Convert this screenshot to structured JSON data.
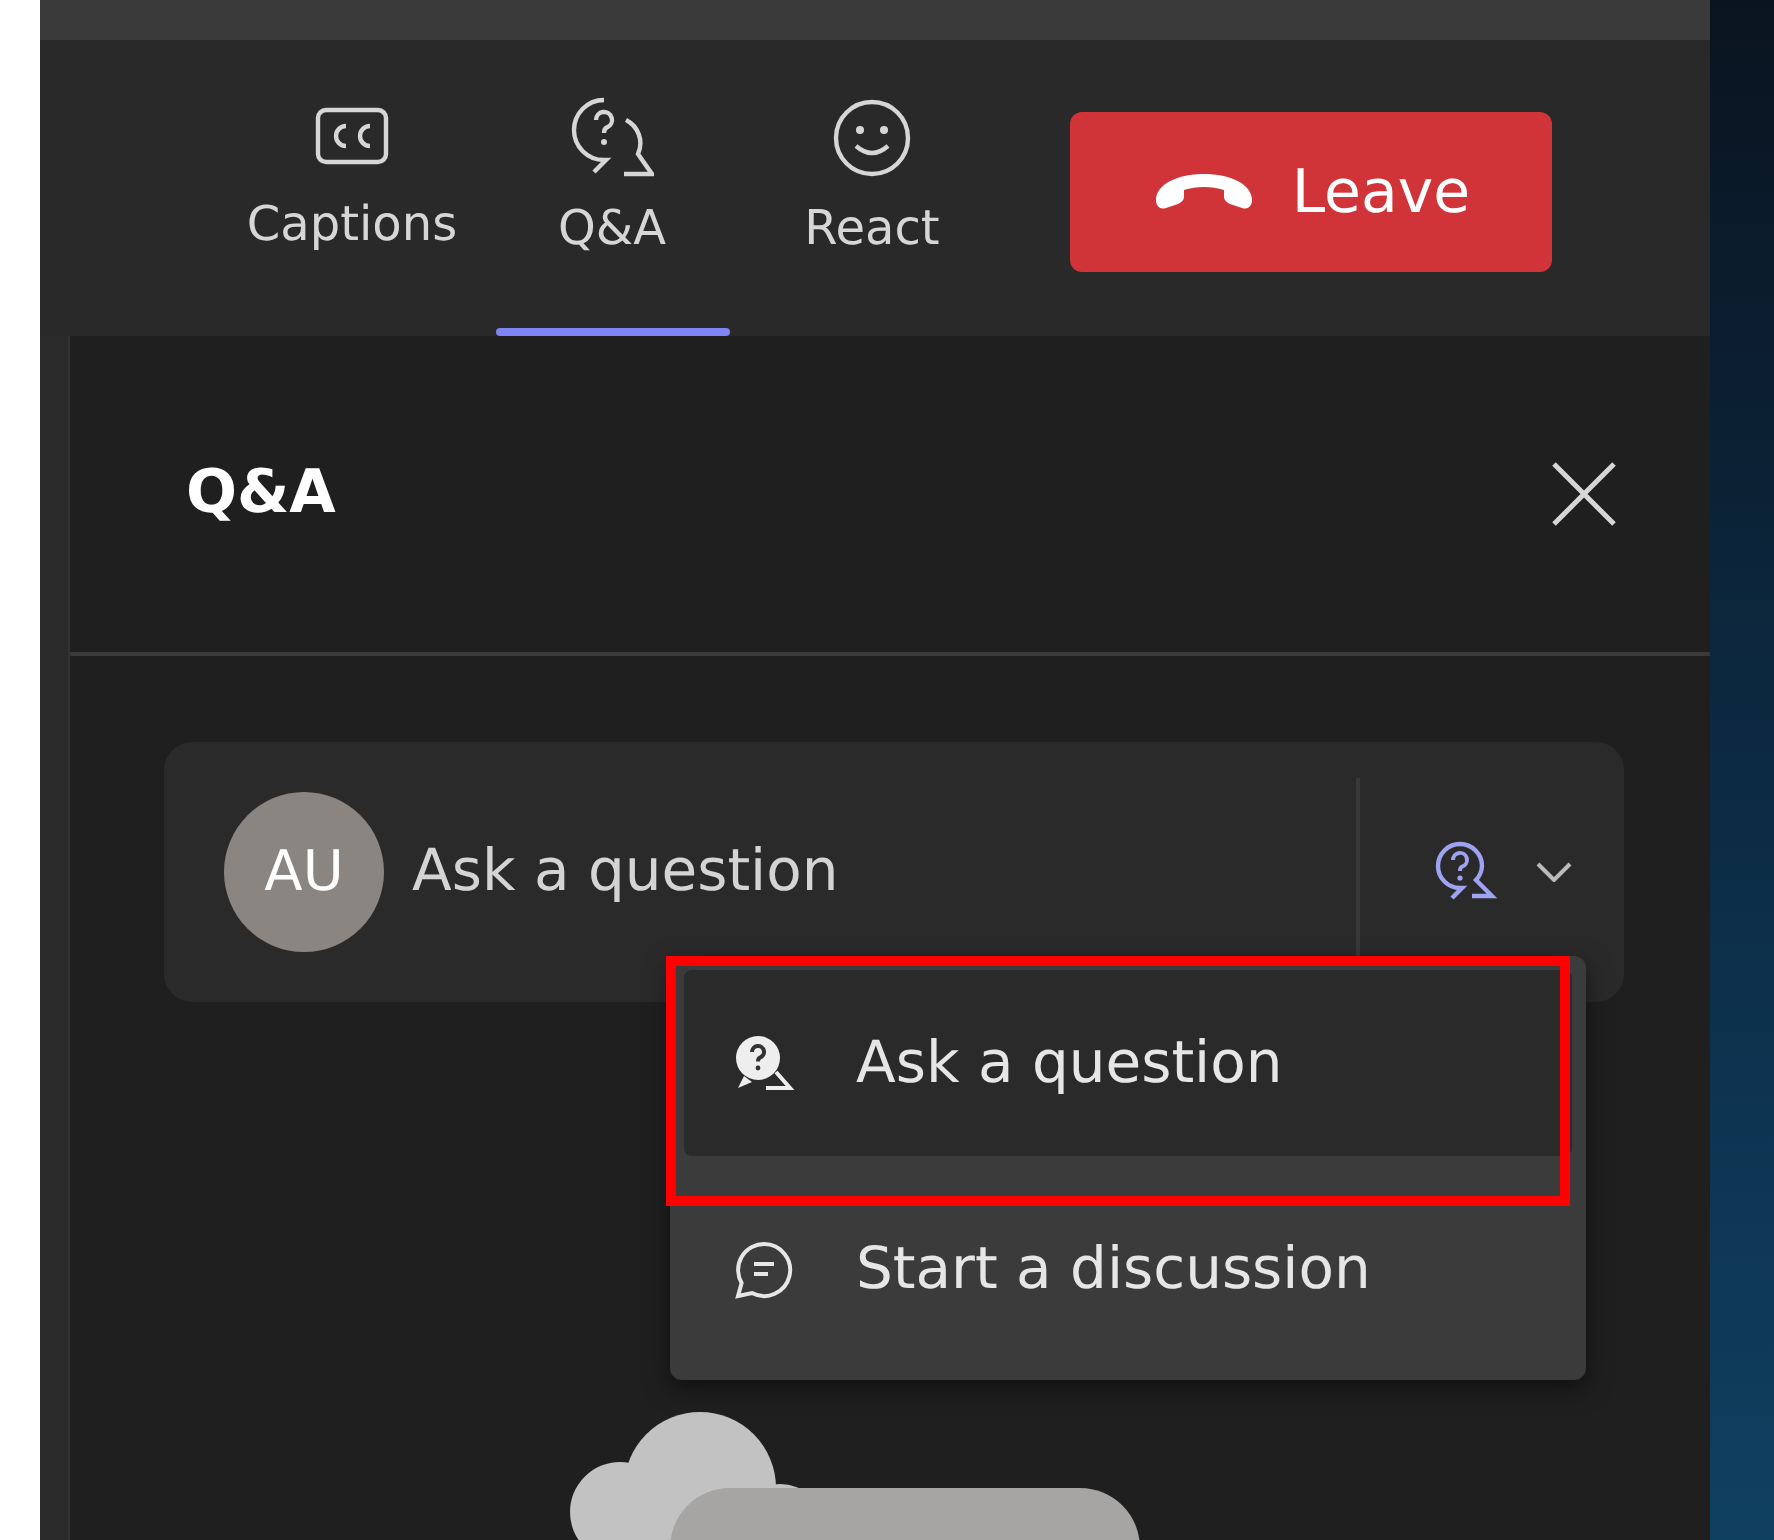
{
  "toolbar": {
    "tabs": [
      {
        "label": "Captions",
        "kind": "captions",
        "selected": false
      },
      {
        "label": "Q&A",
        "kind": "qa",
        "selected": true
      },
      {
        "label": "React",
        "kind": "react",
        "selected": false
      }
    ],
    "leave_button": {
      "label": "Leave"
    }
  },
  "panel": {
    "title": "Q&A",
    "compose": {
      "avatar_initials": "AU",
      "placeholder": "Ask a question"
    },
    "menu": {
      "items": [
        {
          "label": "Ask a question",
          "kind": "question",
          "selected": true
        },
        {
          "label": "Start a discussion",
          "kind": "discussion",
          "selected": false
        }
      ]
    }
  }
}
